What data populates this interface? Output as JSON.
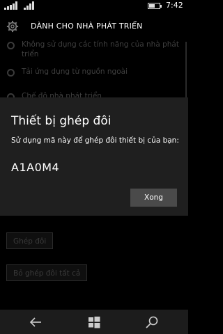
{
  "status": {
    "time": "7:42",
    "battery_level": 0.6
  },
  "header": {
    "title": "DÀNH CHO NHÀ PHÁT TRIỂN"
  },
  "options": [
    {
      "label_line1": "Không sử dụng các tính năng của nhà phát",
      "label_line2": "triển"
    },
    {
      "label_line1": "Tải ứng dụng từ nguồn ngoài"
    },
    {
      "label_line1": "Chế độ nhà phát triển"
    }
  ],
  "dialog": {
    "title": "Thiết bị ghép đôi",
    "message": "Sử dụng mã này để ghép đôi thiết bị của bạn:",
    "code": "A1A0M4",
    "ok_label": "Xong"
  },
  "buttons": {
    "pair_label": "Ghép đôi",
    "unpair_all_label": "Bỏ ghép đôi tất cả"
  },
  "navbar": {
    "icons": [
      "back-icon",
      "windows-icon",
      "search-icon"
    ]
  }
}
